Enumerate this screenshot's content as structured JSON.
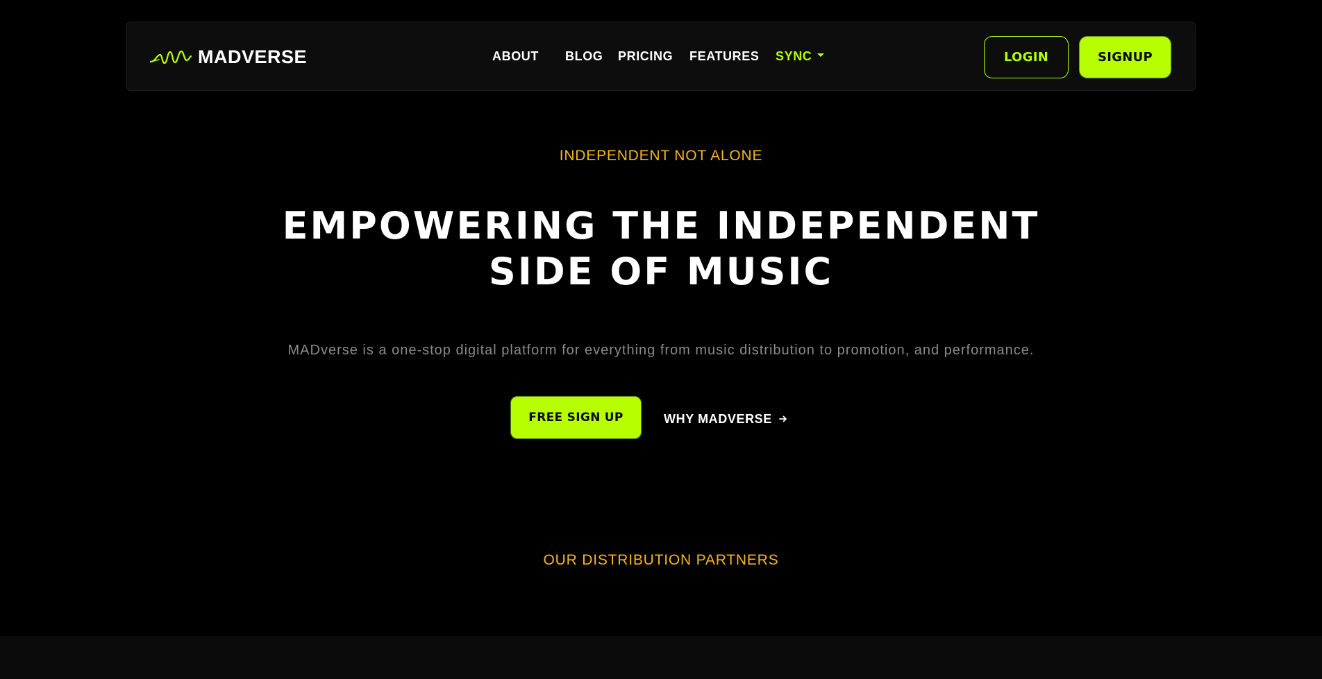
{
  "brand": {
    "name": "MADVERSE",
    "logo_icon": "waveform-logo-icon",
    "accent_color": "#b7ff00"
  },
  "nav": {
    "items": [
      {
        "label": "ABOUT"
      },
      {
        "label": "BLOG"
      },
      {
        "label": "PRICING"
      },
      {
        "label": "FEATURES"
      },
      {
        "label": "SYNC",
        "has_dropdown": true
      }
    ],
    "login_label": "LOGIN",
    "signup_label": "SIGNUP"
  },
  "hero": {
    "eyebrow": "INDEPENDENT NOT ALONE",
    "title_line1": "EMPOWERING THE INDEPENDENT",
    "title_line2": "SIDE OF MUSIC",
    "description": "MADverse is a one-stop digital platform for everything from music distribution to promotion, and performance.",
    "cta_primary": "FREE SIGN UP",
    "cta_secondary": "WHY MADVERSE",
    "cta_secondary_icon": "arrow-right-icon"
  },
  "partners": {
    "title": "OUR DISTRIBUTION PARTNERS"
  },
  "colors": {
    "background": "#000000",
    "navbar_bg": "#0d0d0d",
    "accent": "#b7ff00",
    "eyebrow": "#f5b81d",
    "muted_text": "#8a8a8a"
  }
}
